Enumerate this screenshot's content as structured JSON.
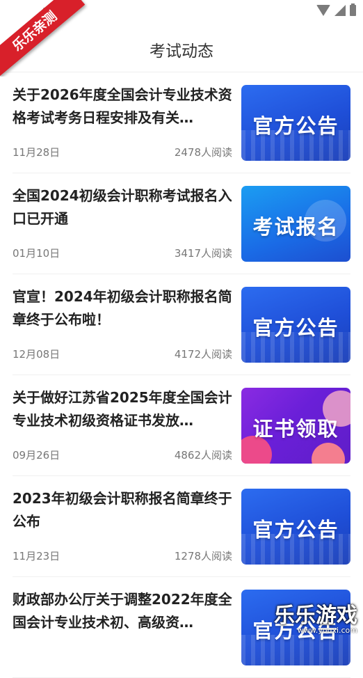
{
  "header": {
    "title": "考试动态",
    "ribbon": "乐乐亲测"
  },
  "news": [
    {
      "title": "关于2026年度全国会计专业技术资格考试考务日程安排及有关…",
      "date": "11月28日",
      "reads": "2478人阅读",
      "thumb": "官方公告",
      "thumb_kind": "notice"
    },
    {
      "title": "全国2024初级会计职称考试报名入口已开通",
      "date": "01月10日",
      "reads": "3417人阅读",
      "thumb": "考试报名",
      "thumb_kind": "reg"
    },
    {
      "title": "官宣！2024年初级会计职称报名简章终于公布啦！",
      "date": "12月08日",
      "reads": "4172人阅读",
      "thumb": "官方公告",
      "thumb_kind": "notice"
    },
    {
      "title": "关于做好江苏省2025年度全国会计专业技术初级资格证书发放…",
      "date": "09月26日",
      "reads": "4862人阅读",
      "thumb": "证书领取",
      "thumb_kind": "cert"
    },
    {
      "title": "2023年初级会计职称报名简章终于公布",
      "date": "11月23日",
      "reads": "1278人阅读",
      "thumb": "官方公告",
      "thumb_kind": "notice"
    },
    {
      "title": "财政部办公厅关于调整2022年度全国会计专业技术初、高级资…",
      "date": "",
      "reads": "",
      "thumb": "官方公告",
      "thumb_kind": "notice"
    }
  ],
  "watermark": {
    "text": "乐乐游戏",
    "url": "www.youxi.com"
  }
}
